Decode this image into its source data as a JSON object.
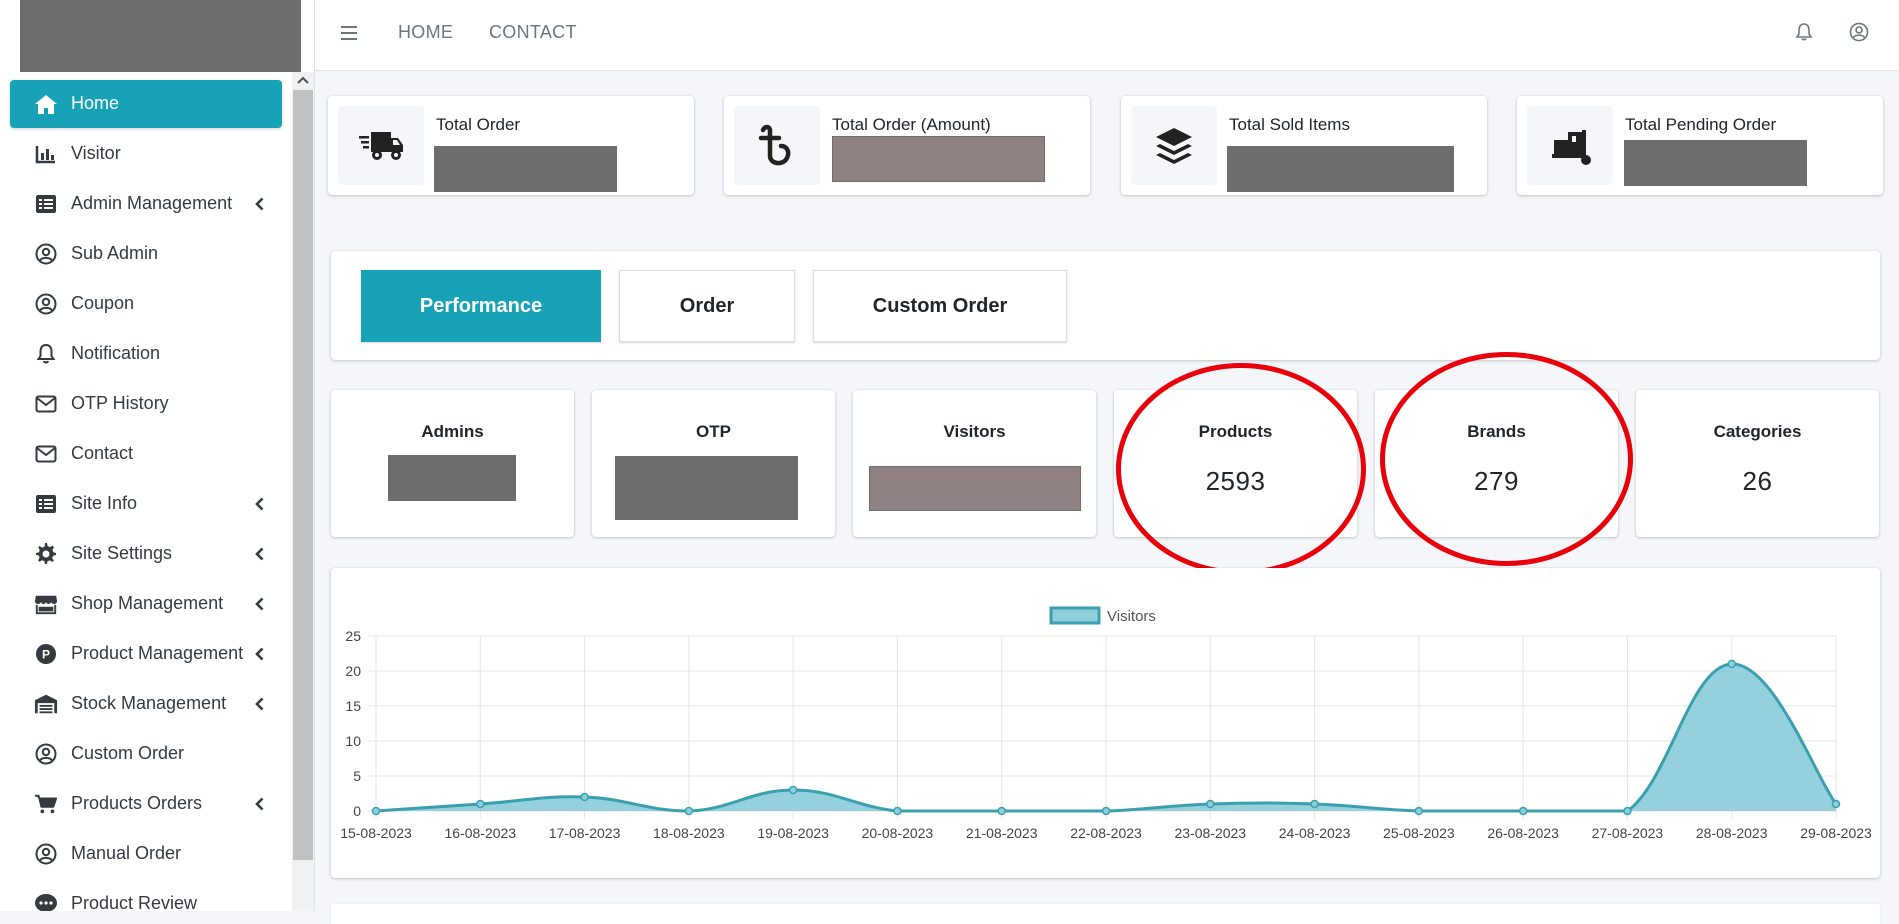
{
  "sidebar": {
    "items": [
      {
        "label": "Home",
        "icon": "home-icon",
        "active": true,
        "caret": false
      },
      {
        "label": "Visitor",
        "icon": "bar-chart-icon",
        "active": false,
        "caret": false
      },
      {
        "label": "Admin Management",
        "icon": "list-icon",
        "active": false,
        "caret": true
      },
      {
        "label": "Sub Admin",
        "icon": "user-circle-icon",
        "active": false,
        "caret": false
      },
      {
        "label": "Coupon",
        "icon": "user-circle-icon",
        "active": false,
        "caret": false
      },
      {
        "label": "Notification",
        "icon": "bell-icon",
        "active": false,
        "caret": false
      },
      {
        "label": "OTP History",
        "icon": "envelope-icon",
        "active": false,
        "caret": false
      },
      {
        "label": "Contact",
        "icon": "envelope-icon",
        "active": false,
        "caret": false
      },
      {
        "label": "Site Info",
        "icon": "list-icon",
        "active": false,
        "caret": true
      },
      {
        "label": "Site Settings",
        "icon": "gear-icon",
        "active": false,
        "caret": true
      },
      {
        "label": "Shop Management",
        "icon": "store-icon",
        "active": false,
        "caret": true
      },
      {
        "label": "Product Management",
        "icon": "product-p-icon",
        "active": false,
        "caret": true
      },
      {
        "label": "Stock Management",
        "icon": "warehouse-icon",
        "active": false,
        "caret": true
      },
      {
        "label": "Custom Order",
        "icon": "user-circle-icon",
        "active": false,
        "caret": false
      },
      {
        "label": "Products Orders",
        "icon": "cart-icon",
        "active": false,
        "caret": true
      },
      {
        "label": "Manual Order",
        "icon": "user-circle-icon",
        "active": false,
        "caret": false
      },
      {
        "label": "Product Review",
        "icon": "comment-dots-icon",
        "active": false,
        "caret": false
      }
    ]
  },
  "header": {
    "links": [
      "HOME",
      "CONTACT"
    ]
  },
  "info_boxes": [
    {
      "label": "Total Order",
      "icon": "truck-icon"
    },
    {
      "label": "Total Order (Amount)",
      "icon": "taka-icon"
    },
    {
      "label": "Total Sold Items",
      "icon": "layers-icon"
    },
    {
      "label": "Total Pending Order",
      "icon": "dolly-icon"
    }
  ],
  "tabs": [
    {
      "label": "Performance",
      "active": true
    },
    {
      "label": "Order",
      "active": false
    },
    {
      "label": "Custom Order",
      "active": false
    }
  ],
  "stats": [
    {
      "title": "Admins",
      "value": null
    },
    {
      "title": "OTP",
      "value": null
    },
    {
      "title": "Visitors",
      "value": null
    },
    {
      "title": "Products",
      "value": "2593",
      "highlighted": true
    },
    {
      "title": "Brands",
      "value": "279",
      "highlighted": true
    },
    {
      "title": "Categories",
      "value": "26"
    }
  ],
  "colors": {
    "accent": "#17a2b8",
    "highlight": "#e8000b",
    "chart_line": "#3aa0b0",
    "chart_fill": "#8fcfdb"
  },
  "chart_data": {
    "type": "area",
    "x": [
      "15-08-2023",
      "16-08-2023",
      "17-08-2023",
      "18-08-2023",
      "19-08-2023",
      "20-08-2023",
      "21-08-2023",
      "22-08-2023",
      "23-08-2023",
      "24-08-2023",
      "25-08-2023",
      "26-08-2023",
      "27-08-2023",
      "28-08-2023",
      "29-08-2023"
    ],
    "series": [
      {
        "name": "Visitors",
        "values": [
          0,
          1,
          2,
          0,
          3,
          0,
          0,
          0,
          1,
          1,
          0,
          0,
          0,
          21,
          1
        ]
      }
    ],
    "ylim": [
      0,
      25
    ],
    "yticks": [
      0,
      5,
      10,
      15,
      20,
      25
    ],
    "legend": "top",
    "grid": true
  }
}
